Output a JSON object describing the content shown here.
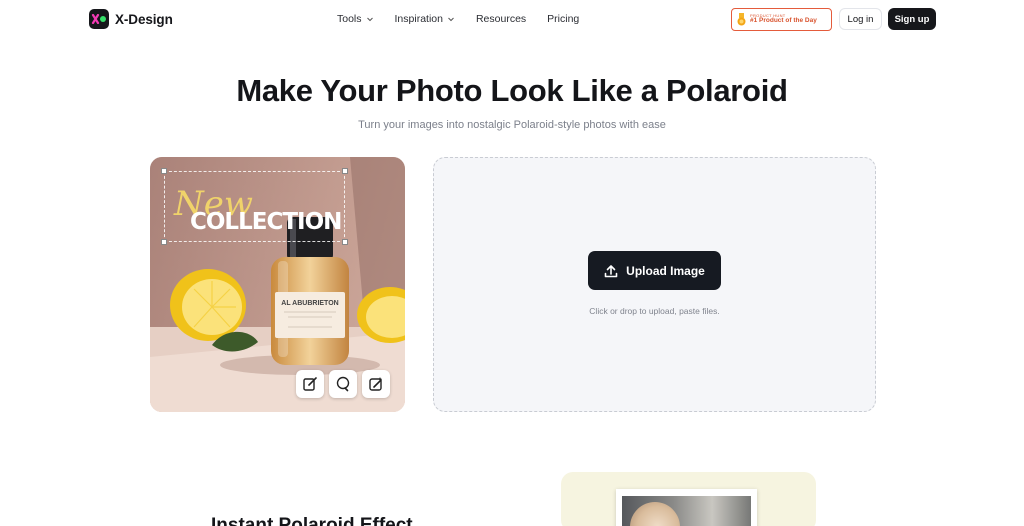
{
  "brand": {
    "name": "X-Design"
  },
  "nav": {
    "items": [
      {
        "label": "Tools",
        "has_dropdown": true
      },
      {
        "label": "Inspiration",
        "has_dropdown": true
      },
      {
        "label": "Resources",
        "has_dropdown": false
      },
      {
        "label": "Pricing",
        "has_dropdown": false
      }
    ],
    "badge": {
      "small": "PRODUCT HUNT",
      "main": "#1 Product of the Day"
    },
    "login_label": "Log in",
    "signup_label": "Sign up"
  },
  "hero": {
    "title": "Make Your Photo Look Like a Polaroid",
    "subtitle": "Turn your images into nostalgic Polaroid-style photos with ease"
  },
  "demo": {
    "overlay_script": "New",
    "overlay_title": "COLLECTION",
    "bottle_label": "AL ABUBRIETON",
    "tool_icons": [
      "edit-icon",
      "lasso-icon",
      "magic-edit-icon"
    ]
  },
  "upload": {
    "button_label": "Upload Image",
    "hint": "Click or drop to upload, paste files."
  },
  "section": {
    "title": "Instant Polaroid Effect"
  },
  "colors": {
    "accent_dark": "#161a22",
    "badge_red": "#d9542f",
    "upload_bg": "#f5f6f9",
    "preview_bg": "#f6f4e0"
  }
}
